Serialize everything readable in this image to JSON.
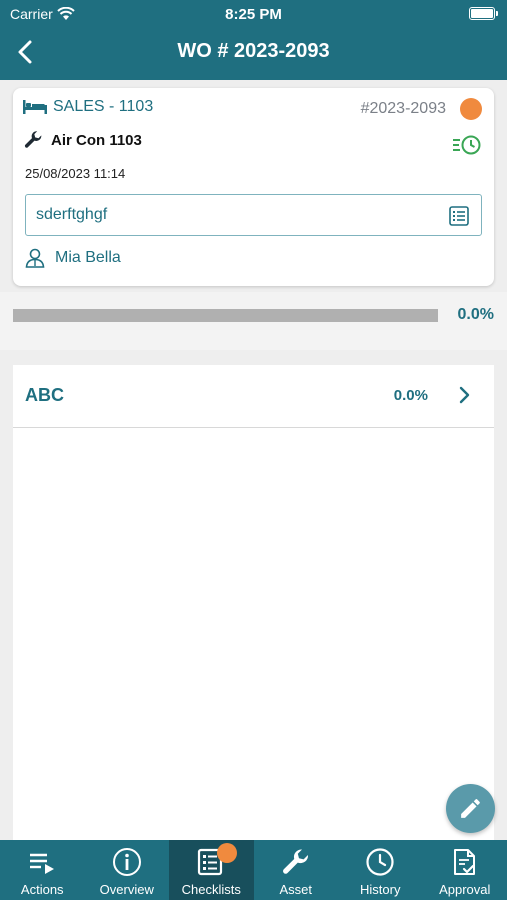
{
  "status_bar": {
    "carrier": "Carrier",
    "time": "8:25 PM",
    "battery_level": 1.0
  },
  "header": {
    "title": "WO # 2023-2093"
  },
  "work_order": {
    "location": "SALES - 1103",
    "number": "#2023-2093",
    "status_color": "#f08a3e",
    "asset": "Air Con 1103",
    "datetime": "25/08/2023 11:14",
    "description": "sderftghgf",
    "assignee": "Mia Bella"
  },
  "progress": {
    "value": 0.0,
    "label": "0.0%"
  },
  "checklists": [
    {
      "name": "ABC",
      "percent": "0.0%"
    }
  ],
  "tabs": [
    {
      "label": "Actions",
      "icon": "actions-icon"
    },
    {
      "label": "Overview",
      "icon": "info-icon"
    },
    {
      "label": "Checklists",
      "icon": "checklist-icon",
      "active": true,
      "badge": true
    },
    {
      "label": "Asset",
      "icon": "wrench-icon"
    },
    {
      "label": "History",
      "icon": "clock-icon"
    },
    {
      "label": "Approval",
      "icon": "approval-icon"
    }
  ],
  "colors": {
    "primary": "#1f6f80",
    "active_tab": "#184f5c",
    "accent": "#f08a3e",
    "fab": "#5a9aaa"
  }
}
